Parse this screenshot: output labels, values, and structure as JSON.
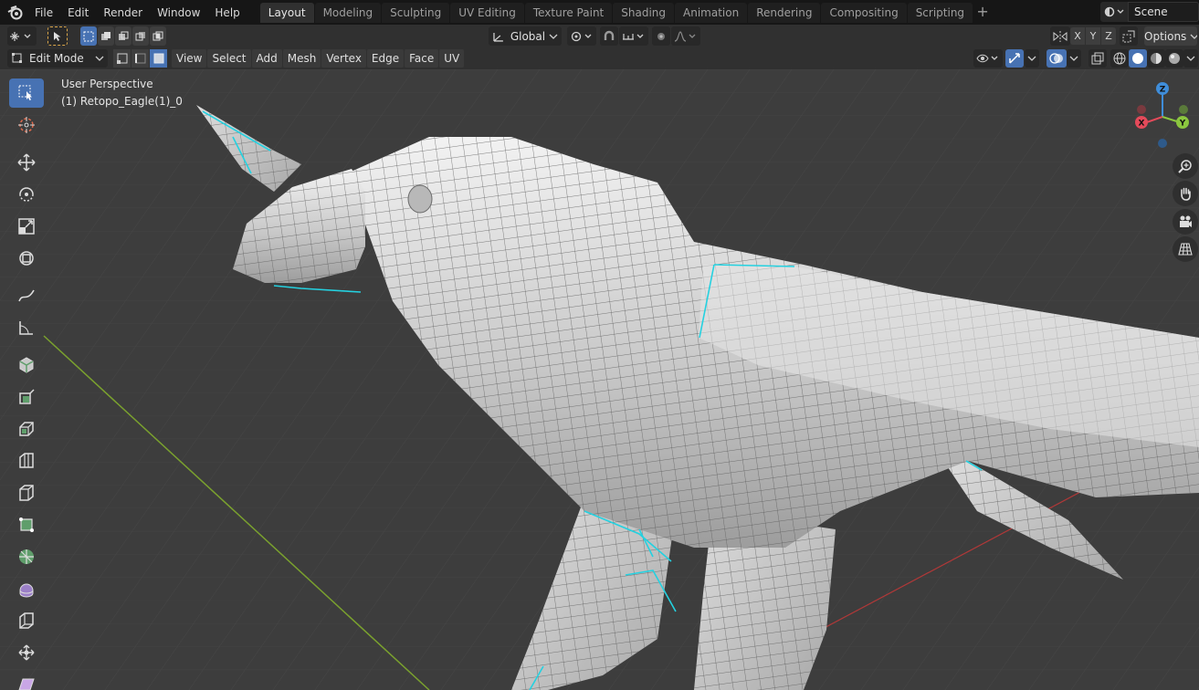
{
  "menus": [
    "File",
    "Edit",
    "Render",
    "Window",
    "Help"
  ],
  "workspaces": [
    {
      "label": "Layout",
      "active": true
    },
    {
      "label": "Modeling",
      "active": false
    },
    {
      "label": "Sculpting",
      "active": false
    },
    {
      "label": "UV Editing",
      "active": false
    },
    {
      "label": "Texture Paint",
      "active": false
    },
    {
      "label": "Shading",
      "active": false
    },
    {
      "label": "Animation",
      "active": false
    },
    {
      "label": "Rendering",
      "active": false
    },
    {
      "label": "Compositing",
      "active": false
    },
    {
      "label": "Scripting",
      "active": false
    }
  ],
  "add_workspace": "+",
  "scene": {
    "label": "Scene"
  },
  "tool_header": {
    "orientation": "Global",
    "axes": [
      "X",
      "Y",
      "Z"
    ],
    "options": "Options"
  },
  "viewport_header": {
    "mode": "Edit Mode",
    "menus": [
      "View",
      "Select",
      "Add",
      "Mesh",
      "Vertex",
      "Edge",
      "Face",
      "UV"
    ]
  },
  "viewport": {
    "perspective": "User Perspective",
    "object": "(1) Retopo_Eagle(1)_0"
  },
  "gizmo": {
    "x": "X",
    "y": "Y",
    "z": "Z"
  },
  "tools": [
    "select-box",
    "cursor",
    "move",
    "rotate",
    "scale",
    "transform",
    "annotate",
    "measure",
    "add-cube",
    "extrude-region",
    "inset-faces",
    "bevel",
    "loop-cut",
    "knife",
    "poly-build",
    "spin",
    "smooth",
    "edge-slide",
    "shrink-fatten",
    "shear"
  ],
  "colors": {
    "accent": "#4772b3",
    "axis_x": "#e44a5a",
    "axis_y": "#8bc63f",
    "axis_z": "#3f8dd9",
    "selection": "#24d1e0"
  }
}
